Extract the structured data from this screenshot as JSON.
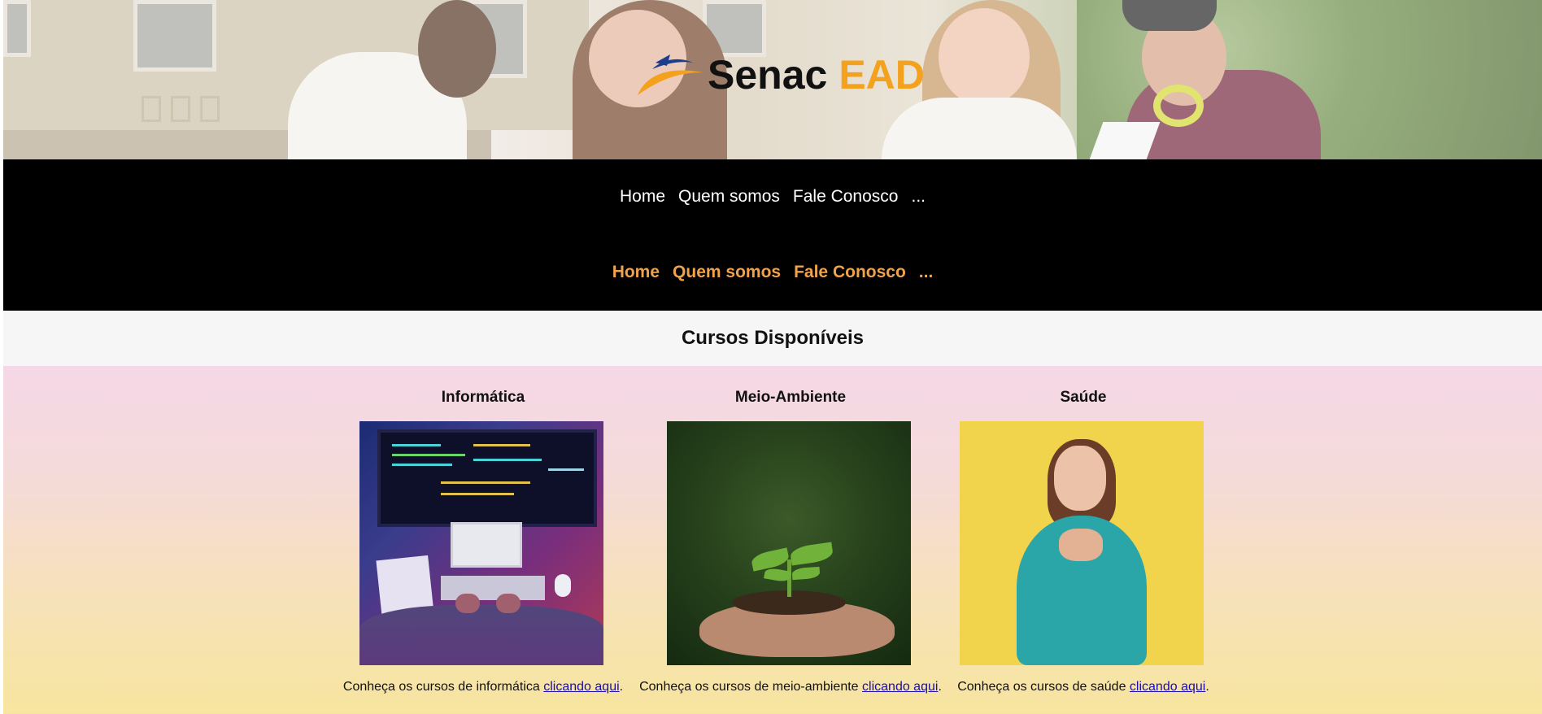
{
  "brand": {
    "name": "Senac",
    "suffix": "EAD",
    "suffix_color": "#f4a11e",
    "mark_color": "#f4a11e",
    "mark_accent": "#1c3f8c"
  },
  "nav_primary": {
    "items": [
      "Home",
      "Quem somos",
      "Fale Conosco",
      "..."
    ]
  },
  "nav_secondary": {
    "items": [
      "Home",
      "Quem somos",
      "Fale Conosco",
      "..."
    ],
    "color": "#f0a24c"
  },
  "section": {
    "title": "Cursos Disponíveis"
  },
  "courses": [
    {
      "title": "Informática",
      "caption_prefix": "Conheça os cursos de informática",
      "link_text": "clicando aqui",
      "caption_suffix": "."
    },
    {
      "title": "Meio-Ambiente",
      "caption_prefix": "Conheça os cursos de meio-ambiente",
      "link_text": "clicando aqui",
      "caption_suffix": "."
    },
    {
      "title": "Saúde",
      "caption_prefix": "Conheça os cursos de saúde",
      "link_text": "clicando aqui",
      "caption_suffix": "."
    }
  ]
}
